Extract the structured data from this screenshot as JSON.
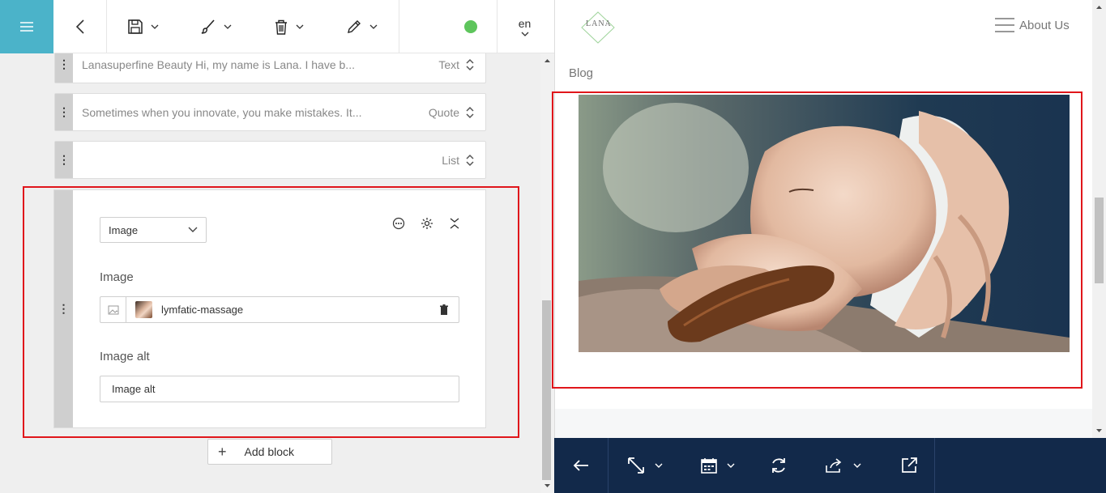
{
  "toolbar": {
    "language": "en",
    "status_color": "#5ec55c",
    "icons": [
      "hamburger-icon",
      "back-icon",
      "save-icon",
      "brush-icon",
      "trash-icon",
      "pen-icon"
    ]
  },
  "blocks": [
    {
      "summary": "Lanasuperfine Beauty Hi, my name is Lana. I have b...",
      "type": "Text"
    },
    {
      "summary": "Sometimes when you innovate, you make mistakes. It...",
      "type": "Quote"
    },
    {
      "summary": "",
      "type": "List"
    }
  ],
  "image_block": {
    "type_select": "Image",
    "image_label": "Image",
    "image_filename": "lymfatic-massage",
    "alt_label": "Image alt",
    "alt_value": "Image alt"
  },
  "add_block_label": "Add block",
  "preview": {
    "logo_text": "LANA",
    "nav_label": "About Us",
    "section_label": "Blog"
  },
  "colors": {
    "accent": "#4bb3c9",
    "highlight": "#e0161b",
    "bottom_bar": "#12294a"
  }
}
